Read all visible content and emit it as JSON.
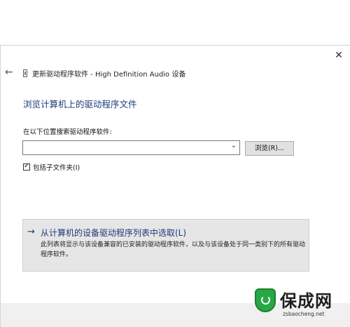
{
  "window": {
    "title": "更新驱动程序软件 - High Definition Audio 设备",
    "close_glyph": "✕",
    "back_glyph": "←"
  },
  "main": {
    "heading": "浏览计算机上的驱动程序文件",
    "search_label": "在以下位置搜索驱动程序软件:",
    "path_value": "",
    "browse_label": "浏览(R)...",
    "include_subfolders_label": "包括子文件夹(I)",
    "include_subfolders_checked": true
  },
  "pick_option": {
    "arrow_glyph": "→",
    "title": "从计算机的设备驱动程序列表中选取(L)",
    "description": "此列表将显示与该设备兼容的已安装的驱动程序软件，以及与该设备处于同一类别下的所有驱动程序软件。"
  },
  "watermark": {
    "brand": "保成网",
    "url": "zsbaocheng.net"
  },
  "colors": {
    "accent": "#1a3a7a",
    "pick_box_bg": "#e6e6e6",
    "footer_bg": "#f0f0f0",
    "watermark_green": "#27a844"
  }
}
